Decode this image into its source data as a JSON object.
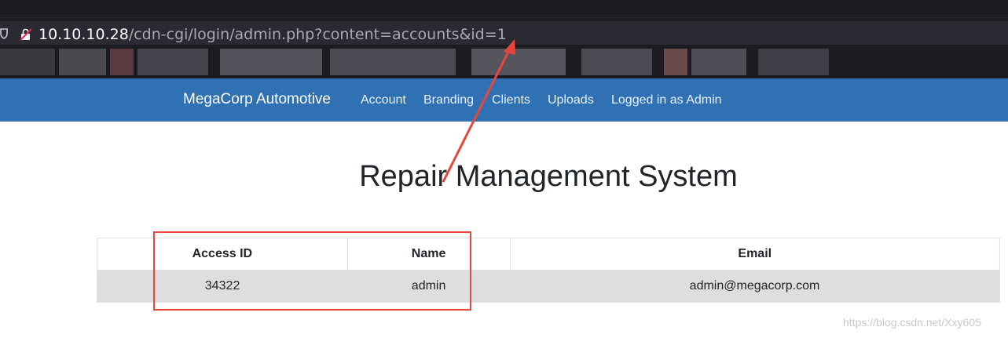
{
  "browser": {
    "url_host": "10.10.10.28",
    "url_path": "/cdn-cgi/login/admin.php?content=accounts&id=1",
    "icons": [
      "shield-icon",
      "insecure-lock-icon"
    ]
  },
  "navbar": {
    "brand": "MegaCorp Automotive",
    "links": [
      "Account",
      "Branding",
      "Clients",
      "Uploads",
      "Logged in as Admin"
    ]
  },
  "page": {
    "title": "Repair Management System"
  },
  "table": {
    "headers": [
      "Access ID",
      "Name",
      "Email"
    ],
    "rows": [
      [
        "34322",
        "admin",
        "admin@megacorp.com"
      ]
    ]
  },
  "watermark": "https://blog.csdn.net/Xxy605",
  "colors": {
    "navbar": "#2f71b2",
    "annotation": "#e8453c",
    "row_highlight": "#dedede"
  }
}
